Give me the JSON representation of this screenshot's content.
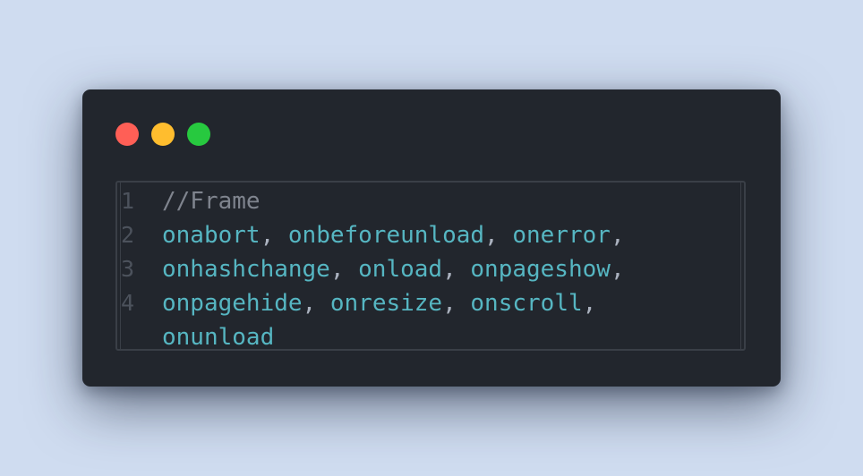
{
  "window": {
    "controls": {
      "close_color": "#ff5f56",
      "minimize_color": "#ffbd2e",
      "maximize_color": "#27c93f"
    }
  },
  "editor": {
    "lines": [
      {
        "number": "1",
        "tokens": [
          {
            "text": "//Frame",
            "kind": "comment"
          }
        ]
      },
      {
        "number": "2",
        "tokens": [
          {
            "text": "onabort",
            "kind": "ident"
          },
          {
            "text": ", ",
            "kind": "punct"
          },
          {
            "text": "onbeforeunload",
            "kind": "ident"
          },
          {
            "text": ", ",
            "kind": "punct"
          },
          {
            "text": "onerror",
            "kind": "ident"
          },
          {
            "text": ",",
            "kind": "punct"
          }
        ]
      },
      {
        "number": "3",
        "tokens": [
          {
            "text": "onhashchange",
            "kind": "ident"
          },
          {
            "text": ", ",
            "kind": "punct"
          },
          {
            "text": "onload",
            "kind": "ident"
          },
          {
            "text": ", ",
            "kind": "punct"
          },
          {
            "text": "onpageshow",
            "kind": "ident"
          },
          {
            "text": ",",
            "kind": "punct"
          }
        ]
      },
      {
        "number": "4",
        "tokens": [
          {
            "text": "onpagehide",
            "kind": "ident"
          },
          {
            "text": ", ",
            "kind": "punct"
          },
          {
            "text": "onresize",
            "kind": "ident"
          },
          {
            "text": ", ",
            "kind": "punct"
          },
          {
            "text": "onscroll",
            "kind": "ident"
          },
          {
            "text": ",",
            "kind": "punct"
          }
        ]
      },
      {
        "number": "",
        "tokens": [
          {
            "text": "onunload",
            "kind": "ident"
          }
        ]
      }
    ]
  }
}
